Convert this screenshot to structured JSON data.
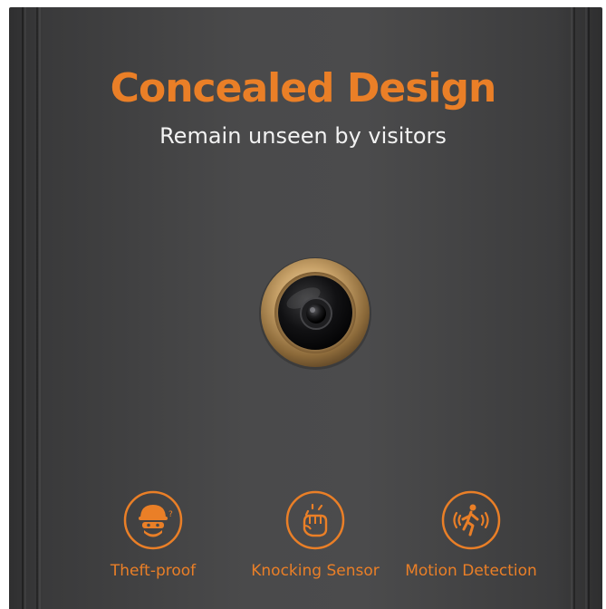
{
  "headline": "Concealed Design",
  "subheadline": "Remain unseen by visitors",
  "colors": {
    "accent": "#ea7f27",
    "door": "#4a4a4b",
    "text_light": "#f2f2f2",
    "ring_gold": "#c9a36a"
  },
  "features": [
    {
      "label": "Theft-proof",
      "icon": "thief-icon"
    },
    {
      "label": "Knocking Sensor",
      "icon": "knocking-hand-icon"
    },
    {
      "label": "Motion Detection",
      "icon": "motion-person-icon"
    }
  ]
}
